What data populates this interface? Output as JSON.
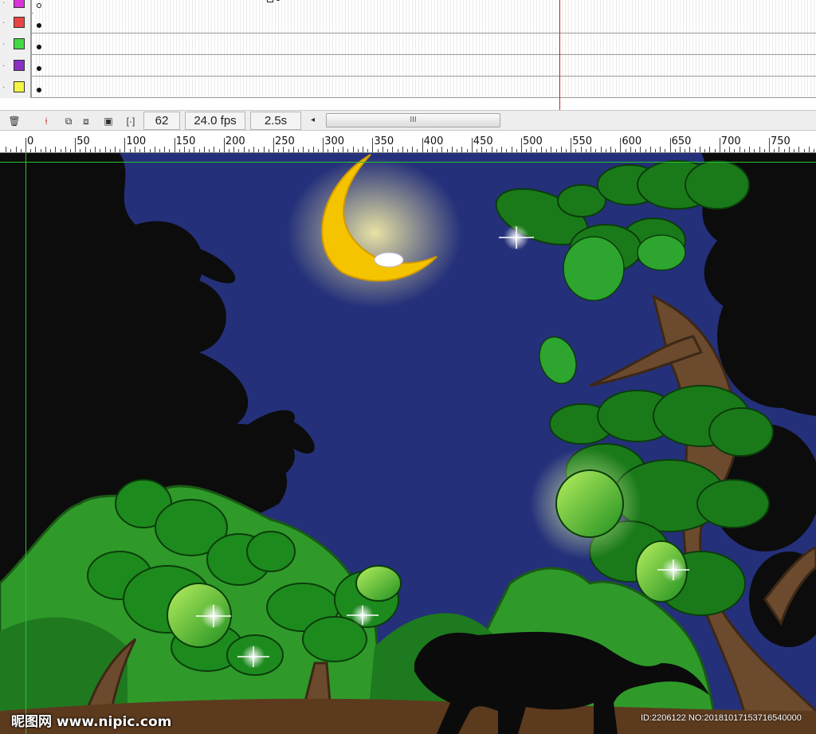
{
  "timeline": {
    "layers": [
      {
        "color": "#d832d8",
        "keyframe": "hollow",
        "tween": true
      },
      {
        "color": "#e84444",
        "keyframe": "filled",
        "tween": false
      },
      {
        "color": "#44d844",
        "keyframe": "filled",
        "tween": false
      },
      {
        "color": "#8a2fc2",
        "keyframe": "filled",
        "tween": false
      },
      {
        "color": "#f4f444",
        "keyframe": "filled",
        "tween": false
      }
    ]
  },
  "statusbar": {
    "trash_icon": "🗑",
    "onion_icon": "⍿",
    "edit_multi_icon": "⧉",
    "onion_outline_icon": "⧈",
    "edit_multiple_icon": "▣",
    "markers_icon": "[·]",
    "current_frame": "62",
    "frame_rate": "24.0 fps",
    "elapsed_time": "2.5s",
    "scroll_left_arrow": "◂",
    "scroll_grip": "III"
  },
  "ruler": {
    "labels": [
      "0",
      "50",
      "100",
      "150",
      "200",
      "250",
      "300",
      "350",
      "400",
      "450",
      "500",
      "550",
      "600",
      "650",
      "700",
      "750"
    ]
  },
  "watermark": {
    "site": "昵图网 www.nipic.com",
    "id_text": "ID:2206122 NO:20181017153716540000"
  },
  "colors": {
    "sky": "#24307a",
    "moon": "#f5c400",
    "leaf_dark": "#0d0d0d",
    "leaf_green": "#1d8a1d",
    "bush_green": "#2f9a2a",
    "ground": "#5c3a1e",
    "playhead": "#c0292b"
  }
}
